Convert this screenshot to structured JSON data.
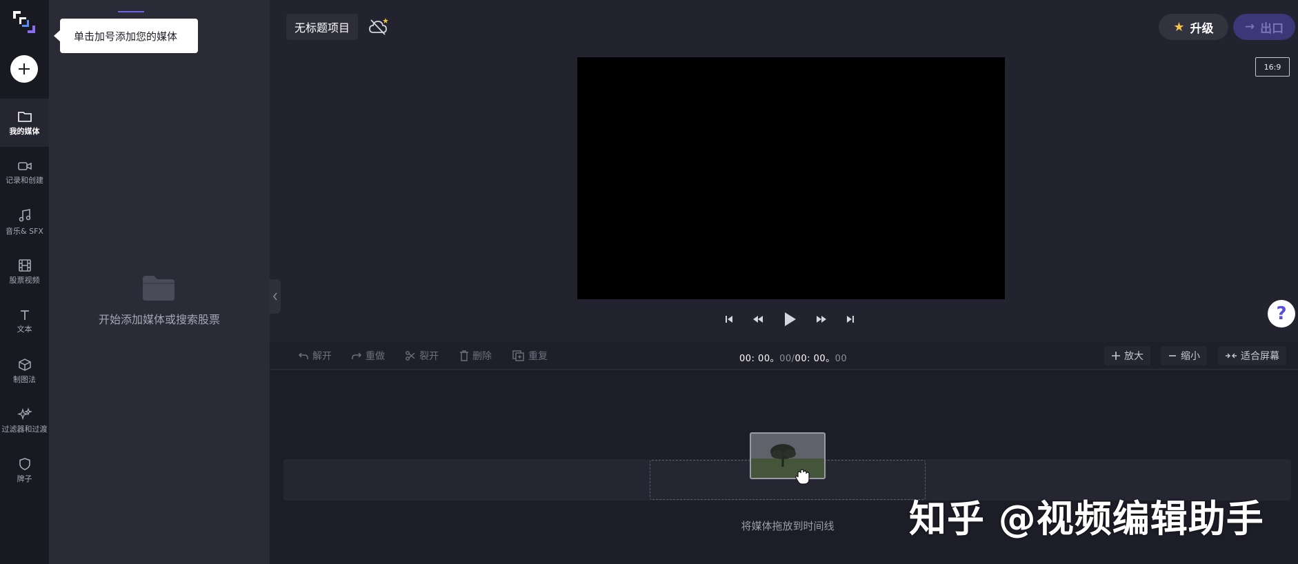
{
  "tooltip": {
    "text": "单击加号添加您的媒体"
  },
  "sidebar": {
    "items": [
      {
        "label": "我的媒体",
        "icon": "folder-icon",
        "active": true
      },
      {
        "label": "记录和创建",
        "icon": "video-camera-icon",
        "active": false
      },
      {
        "label": "音乐& SFX",
        "icon": "music-note-icon",
        "active": false
      },
      {
        "label": "股票视频",
        "icon": "film-icon",
        "active": false
      },
      {
        "label": "文本",
        "icon": "text-icon",
        "active": false
      },
      {
        "label": "制图法",
        "icon": "cube-icon",
        "active": false
      },
      {
        "label": "过滤器和过渡",
        "icon": "sparkles-icon",
        "active": false
      },
      {
        "label": "牌子",
        "icon": "shield-icon",
        "active": false
      }
    ]
  },
  "media_panel": {
    "empty_text": "开始添加媒体或搜索股票"
  },
  "header": {
    "project_title": "无标题项目",
    "upgrade_label": "升级",
    "export_label": "出口"
  },
  "preview": {
    "aspect_ratio": "16:9"
  },
  "timeline_toolbar": {
    "undo_label": "解开",
    "redo_label": "重做",
    "split_label": "裂开",
    "delete_label": "删除",
    "duplicate_label": "重复",
    "zoom_in_label": "放大",
    "zoom_out_label": "缩小",
    "fit_label": "适合屏幕",
    "time_current": "00: 00。",
    "time_current_frames": "00",
    "time_separator": "/",
    "time_total": "00: 00。",
    "time_total_frames": "00"
  },
  "timeline": {
    "drop_text": "将媒体拖放到时间线"
  },
  "watermark": {
    "text": "知乎 @视频编辑助手"
  },
  "colors": {
    "accent": "#6f63e8",
    "upgrade_star": "#f5c542",
    "export_bg": "#3a3876"
  }
}
